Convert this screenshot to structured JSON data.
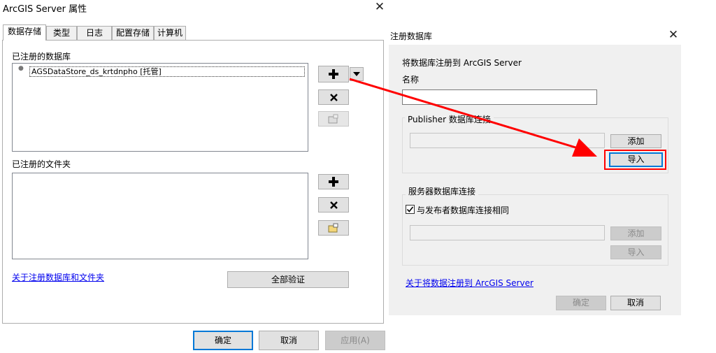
{
  "props_dialog": {
    "title": "ArcGIS Server 属性",
    "tabs": [
      {
        "label": "数据存储"
      },
      {
        "label": "类型"
      },
      {
        "label": "日志"
      },
      {
        "label": "配置存储"
      },
      {
        "label": "计算机"
      }
    ],
    "registered_databases_label": "已注册的数据库",
    "database_items": [
      "AGSDataStore_ds_krtdnpho [托管]"
    ],
    "registered_folders_label": "已注册的文件夹",
    "about_link": "关于注册数据库和文件夹",
    "validate_all_label": "全部验证",
    "ok_label": "确定",
    "cancel_label": "取消",
    "apply_label": "应用(A)"
  },
  "register_dialog": {
    "title": "注册数据库",
    "intro": "将数据库注册到 ArcGIS Server",
    "name_label": "名称",
    "name_value": "",
    "publisher_group_label": "Publisher 数据库连接",
    "add_label": "添加",
    "import_label": "导入",
    "server_group_label": "服务器数据库连接",
    "same_as_publisher_label": "与发布者数据库连接相同",
    "same_as_publisher_checked": true,
    "add_disabled_label": "添加",
    "import_disabled_label": "导入",
    "about_link": "关于将数据注册到 ArcGIS Server",
    "ok_label": "确定",
    "cancel_label": "取消"
  },
  "annotation_color": "#ff0000",
  "icons": {
    "add": "plus-icon",
    "remove": "x-icon",
    "properties": "folder-properties-icon",
    "dropdown": "chevron-down-icon",
    "close": "close-icon"
  }
}
